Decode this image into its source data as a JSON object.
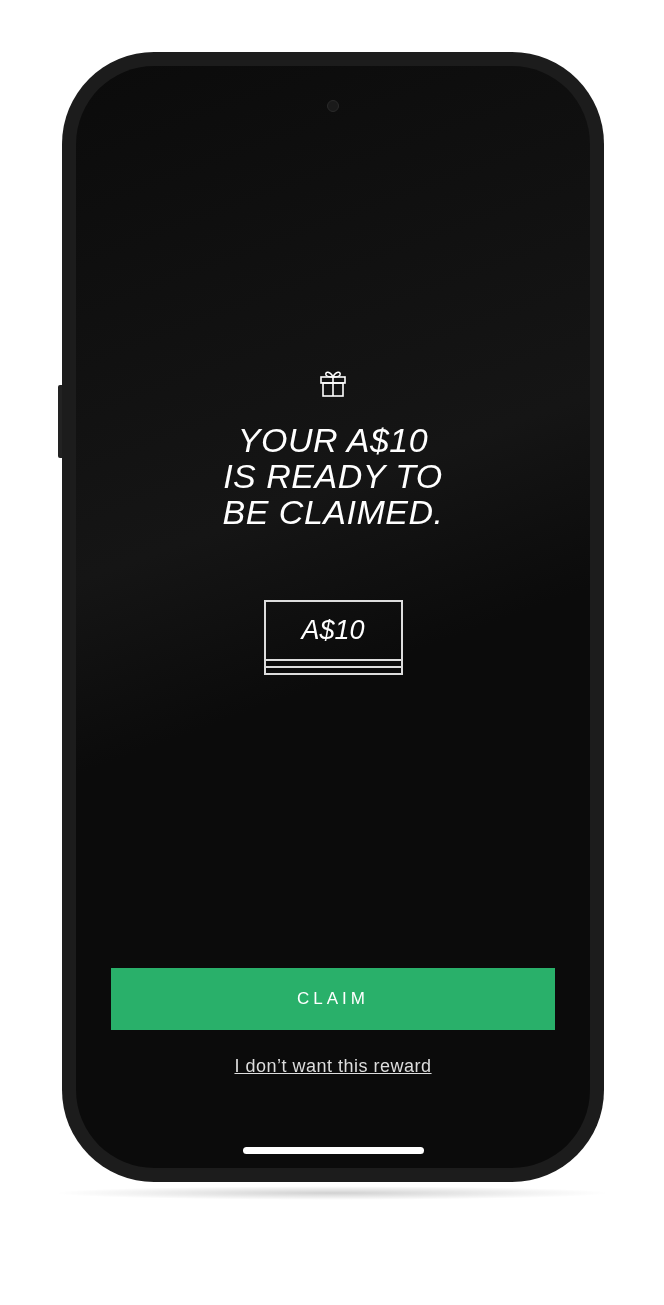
{
  "headline_lines": [
    "YOUR A$10",
    "IS READY TO",
    "BE CLAIMED."
  ],
  "voucher": {
    "amount": "A$10"
  },
  "claim_button": {
    "label": "CLAIM"
  },
  "decline_link": {
    "label": "I don’t want this reward"
  }
}
